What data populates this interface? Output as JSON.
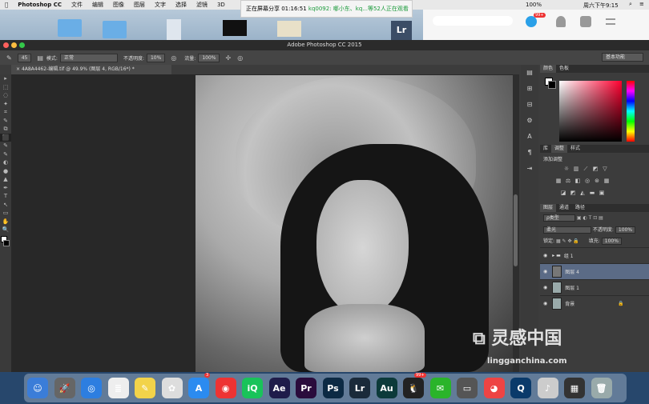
{
  "menubar": {
    "app": "Photoshop CC",
    "items": [
      "文件",
      "编辑",
      "图像",
      "图层",
      "文字",
      "选择",
      "滤镜",
      "3D"
    ],
    "battery": "100%",
    "clock": "周六下午9:15"
  },
  "share": {
    "text": "正在屏幕分享 01:16:51",
    "highlight": "kq0092: 哪小东、kq...等52人正在观看"
  },
  "chat": {
    "badge": "99+"
  },
  "window": {
    "title": "Adobe Photoshop CC 2015",
    "workspace": "基本功能"
  },
  "options": {
    "brush_size": "45",
    "mode_label": "模式:",
    "mode_value": "正常",
    "opacity_label": "不透明度:",
    "opacity_value": "10%",
    "flow_label": "流量:",
    "flow_value": "100%"
  },
  "document": {
    "tab": "4A8A4462-编辑.tif @ 49.9% (图层 4, RGB/16*) *"
  },
  "tools": [
    "▸",
    "⬚",
    "◌",
    "✦",
    "⌗",
    "✎",
    "⧉",
    "⬛",
    "✎",
    "✎",
    "◐",
    "●",
    "▲",
    "✒",
    "T",
    "↖",
    "▭",
    "✋",
    "🔍"
  ],
  "strip": [
    "▤",
    "⊞",
    "⊟",
    "⚙",
    "A",
    "¶",
    "⇥"
  ],
  "color_panel": {
    "tabs": [
      "颜色",
      "色板"
    ]
  },
  "adjust_panel": {
    "tabs": [
      "库",
      "调整",
      "样式"
    ],
    "title": "添加调整"
  },
  "layers_panel": {
    "tabs": [
      "图层",
      "通道",
      "路径"
    ],
    "filter": "ρ类型",
    "blend": "柔光",
    "opacity_label": "不透明度:",
    "opacity_value": "100%",
    "lock_label": "锁定:",
    "fill_label": "填充:",
    "fill_value": "100%",
    "layers": [
      {
        "name": "组 1"
      },
      {
        "name": "图层 4"
      },
      {
        "name": "图层 1"
      },
      {
        "name": "背景"
      }
    ]
  },
  "watermark": {
    "cn": "灵感中国",
    "url": "lingganchina.com"
  },
  "dock": [
    {
      "label": "☺",
      "color": "#3b7dd8"
    },
    {
      "label": "🚀",
      "color": "#666"
    },
    {
      "label": "◎",
      "color": "#2d7ee0"
    },
    {
      "label": "≣",
      "color": "#eee"
    },
    {
      "label": "✎",
      "color": "#f2d34a"
    },
    {
      "label": "✿",
      "color": "#ddd"
    },
    {
      "label": "A",
      "color": "#2b8bf0"
    },
    {
      "label": "◉",
      "color": "#e33"
    },
    {
      "label": "iQ",
      "color": "#19c35a"
    },
    {
      "label": "Ae",
      "color": "#1f1c4a"
    },
    {
      "label": "Pr",
      "color": "#2a0c3c"
    },
    {
      "label": "Ps",
      "color": "#0c2a44"
    },
    {
      "label": "Lr",
      "color": "#1a2a3a"
    },
    {
      "label": "Au",
      "color": "#0c3a3a"
    },
    {
      "label": "🐧",
      "color": "#222"
    },
    {
      "label": "✉",
      "color": "#2ab42a"
    },
    {
      "label": "▭",
      "color": "#555"
    },
    {
      "label": "◕",
      "color": "#e44"
    },
    {
      "label": "Q",
      "color": "#0a3a6a"
    },
    {
      "label": "♪",
      "color": "#ccc"
    },
    {
      "label": "▦",
      "color": "#333"
    },
    {
      "label": "🗑",
      "color": "#9aa"
    }
  ],
  "dock_badges": {
    "appstore": "3",
    "qq": "99+"
  }
}
